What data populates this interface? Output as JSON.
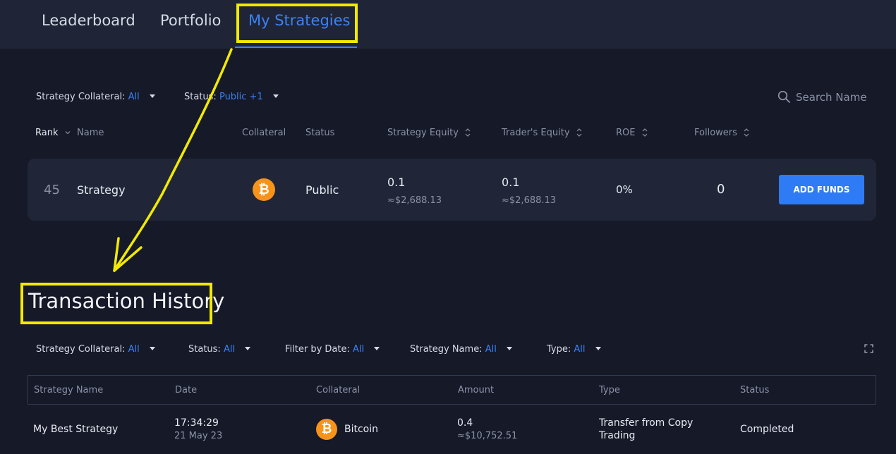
{
  "nav": {
    "tabs": [
      {
        "label": "Leaderboard",
        "active": false
      },
      {
        "label": "Portfolio",
        "active": false
      },
      {
        "label": "My Strategies",
        "active": true
      }
    ]
  },
  "filters": {
    "collateral_label": "Strategy Collateral:",
    "collateral_value": "All",
    "status_label": "Status:",
    "status_value": "Public +1"
  },
  "search": {
    "placeholder": "Search Name",
    "icon": "search-icon"
  },
  "strategy_table": {
    "headers": [
      "Rank",
      "Name",
      "Collateral",
      "Status",
      "Strategy Equity",
      "Trader's Equity",
      "ROE",
      "Followers"
    ],
    "rows": [
      {
        "rank": "45",
        "name": "Strategy",
        "collateral_icon": "bitcoin-icon",
        "status": "Public",
        "strategy_equity": "0.1",
        "strategy_equity_usd": "≈$2,688.13",
        "traders_equity": "0.1",
        "traders_equity_usd": "≈$2,688.13",
        "roe": "0%",
        "followers": "0",
        "action_label": "ADD FUNDS"
      }
    ]
  },
  "transaction_history": {
    "title": "Transaction History",
    "filters": {
      "collateral_label": "Strategy Collateral:",
      "collateral_value": "All",
      "status_label": "Status:",
      "status_value": "All",
      "date_label": "Filter by Date:",
      "date_value": "All",
      "name_label": "Strategy Name:",
      "name_value": "All",
      "type_label": "Type:",
      "type_value": "All"
    },
    "headers": [
      "Strategy Name",
      "Date",
      "Collateral",
      "Amount",
      "Type",
      "Status"
    ],
    "rows": [
      {
        "strategy_name": "My Best Strategy",
        "time": "17:34:29",
        "date": "21 May 23",
        "collateral": "Bitcoin",
        "amount": "0.4",
        "amount_usd": "≈$10,752.51",
        "type_line1": "Transfer from Copy",
        "type_line2": "Trading",
        "status": "Completed"
      }
    ]
  },
  "colors": {
    "background": "#151928",
    "nav": "#1f2536",
    "accent": "#3b82f6",
    "button": "#2f7bf5",
    "bitcoin": "#f7931a",
    "annotation": "#f2ea00"
  }
}
